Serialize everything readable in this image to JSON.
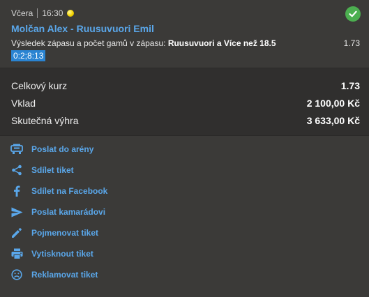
{
  "bet": {
    "day": "Včera",
    "time": "16:30",
    "sport_icon": "tennis-ball-icon",
    "status_icon": "checkmark-circle-icon",
    "match": "Molčan Alex - Ruusuvuori Emil",
    "market_prefix": "Výsledek zápasu a počet gamů v zápasu:",
    "selection": "Ruusuvuori a Více než 18.5",
    "odds": "1.73",
    "score": "0:2;8:13"
  },
  "summary": {
    "total_odds_label": "Celkový kurz",
    "total_odds_value": "1.73",
    "stake_label": "Vklad",
    "stake_value": "2 100,00 Kč",
    "win_label": "Skutečná výhra",
    "win_value": "3 633,00 Kč"
  },
  "actions": [
    {
      "label": "Poslat do arény",
      "icon": "arena-icon"
    },
    {
      "label": "Sdílet tiket",
      "icon": "share-icon"
    },
    {
      "label": "Sdílet na Facebook",
      "icon": "facebook-icon"
    },
    {
      "label": "Poslat kamarádovi",
      "icon": "send-icon"
    },
    {
      "label": "Pojmenovat tiket",
      "icon": "pencil-icon"
    },
    {
      "label": "Vytisknout tiket",
      "icon": "printer-icon"
    },
    {
      "label": "Reklamovat tiket",
      "icon": "sad-face-icon"
    }
  ],
  "colors": {
    "background": "#3b3a38",
    "summary_background": "#302f2e",
    "link": "#5aa7ea",
    "success": "#4caf50",
    "score_badge": "#2a84d2"
  }
}
